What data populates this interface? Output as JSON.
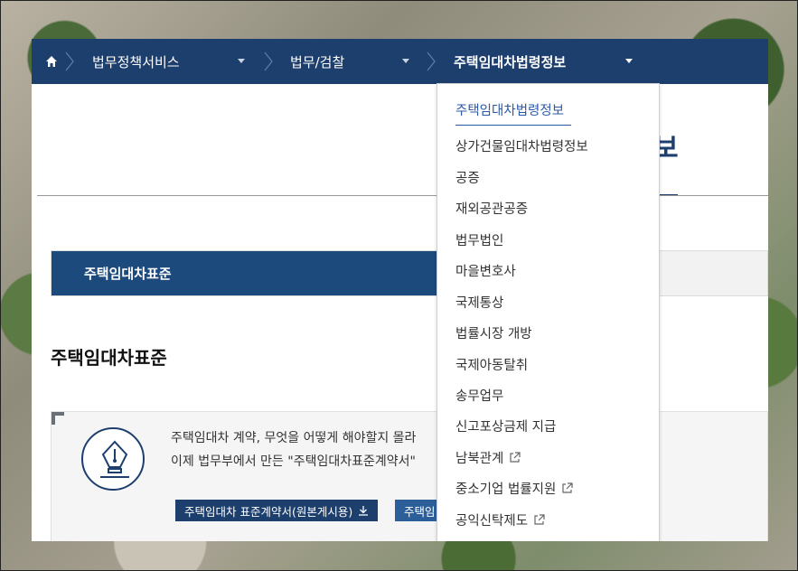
{
  "breadcrumb": {
    "home_icon": "home-icon",
    "items": [
      {
        "label": "법무정책서비스"
      },
      {
        "label": "법무/검찰"
      },
      {
        "label": "주택임대차법령정보"
      }
    ]
  },
  "page": {
    "title_fragment": "보"
  },
  "tabs": {
    "active_label": "주택임대차표준"
  },
  "section": {
    "title": "주택임대차표준"
  },
  "info": {
    "icon": "fountain-pen-icon",
    "line1": "주택임대차 계약, 무엇을 어떻게 해야할지 몰라",
    "line2": "이제 법무부에서 만든 \"주택임대차표준계약서\"",
    "button1": "주택임대차 표준계약서(원본게시용)",
    "button2": "주택임"
  },
  "dropdown": {
    "items": [
      {
        "label": "주택임대차법령정보",
        "selected": true,
        "external": false
      },
      {
        "label": "상가건물임대차법령정보",
        "external": false
      },
      {
        "label": "공증",
        "external": false
      },
      {
        "label": "재외공관공증",
        "external": false
      },
      {
        "label": "법무법인",
        "external": false
      },
      {
        "label": "마을변호사",
        "external": false
      },
      {
        "label": "국제통상",
        "external": false
      },
      {
        "label": "법률시장 개방",
        "external": false
      },
      {
        "label": "국제아동탈취",
        "external": false
      },
      {
        "label": "송무업무",
        "external": false
      },
      {
        "label": "신고포상금제 지급",
        "external": false
      },
      {
        "label": "남북관계",
        "external": true
      },
      {
        "label": "중소기업 법률지원",
        "external": true
      },
      {
        "label": "공익신탁제도",
        "external": true
      }
    ]
  },
  "colors": {
    "nav_bg": "#1d3f6e",
    "tab_active_bg": "#1d4a7c",
    "selected_link": "#2b5aa8"
  }
}
